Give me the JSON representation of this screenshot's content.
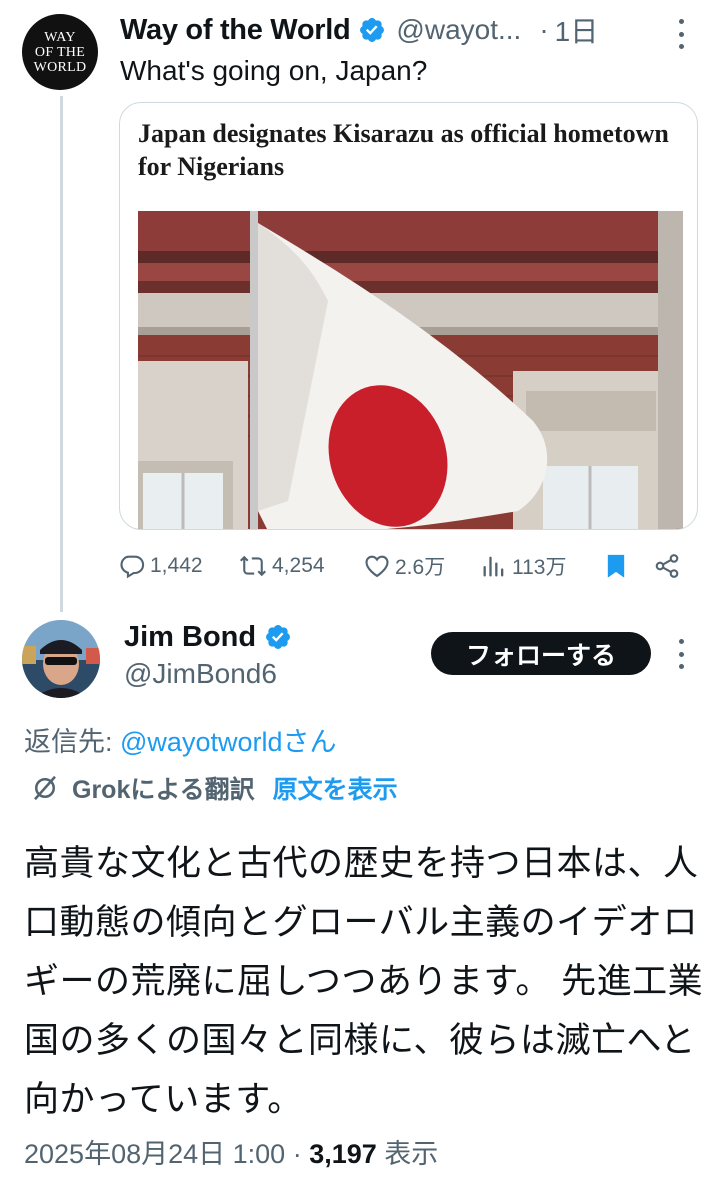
{
  "tweet1": {
    "avatar_text": [
      "WAY",
      "OF THE",
      "WORLD"
    ],
    "name": "Way of the World",
    "handle": "@wayot...",
    "time": "1日",
    "text": "What's going on, Japan?",
    "card_title": "Japan designates Kisarazu as official hometown for Nigerians",
    "stats": {
      "replies": "1,442",
      "reposts": "4,254",
      "likes": "2.6万",
      "views": "113万"
    }
  },
  "tweet2": {
    "name": "Jim Bond",
    "handle": "@JimBond6",
    "follow_label": "フォローする",
    "reply_prefix": "返信先: ",
    "reply_handle": "@wayotworldさん",
    "translation_label": "Grokによる翻訳",
    "show_original": "原文を表示",
    "text": "高貴な文化と古代の歴史を持つ日本は、人口動態の傾向とグローバル主義のイデオロギーの荒廃に屈しつつあります。 先進工業国の多くの国々と同様に、彼らは滅亡へと向かっています。",
    "date": "2025年08月24日 1:00",
    "view_count": "3,197",
    "view_label": "表示"
  },
  "colors": {
    "accent": "#1d9bf0",
    "text": "#0f1419",
    "secondary": "#536471",
    "border": "#cfd9de"
  }
}
